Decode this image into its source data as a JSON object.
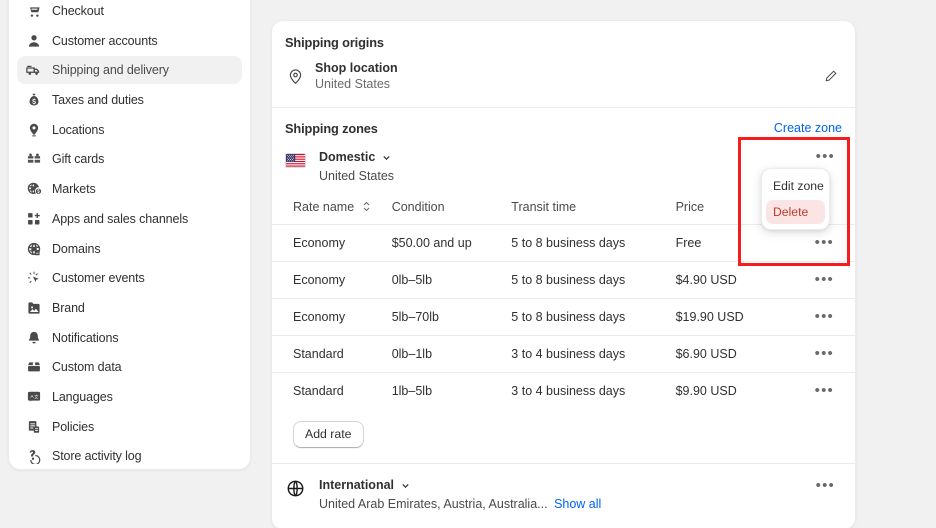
{
  "sidebar": {
    "items": [
      {
        "label": "Checkout",
        "icon": "cart-icon",
        "active": false
      },
      {
        "label": "Customer accounts",
        "icon": "person-icon",
        "active": false
      },
      {
        "label": "Shipping and delivery",
        "icon": "truck-icon",
        "active": true
      },
      {
        "label": "Taxes and duties",
        "icon": "money-bag-icon",
        "active": false
      },
      {
        "label": "Locations",
        "icon": "pin-icon",
        "active": false
      },
      {
        "label": "Gift cards",
        "icon": "gift-card-icon",
        "active": false
      },
      {
        "label": "Markets",
        "icon": "globe-money-icon",
        "active": false
      },
      {
        "label": "Apps and sales channels",
        "icon": "apps-icon",
        "active": false
      },
      {
        "label": "Domains",
        "icon": "domain-globe-icon",
        "active": false
      },
      {
        "label": "Customer events",
        "icon": "cursor-click-icon",
        "active": false
      },
      {
        "label": "Brand",
        "icon": "brand-image-icon",
        "active": false
      },
      {
        "label": "Notifications",
        "icon": "bell-icon",
        "active": false
      },
      {
        "label": "Custom data",
        "icon": "database-icon",
        "active": false
      },
      {
        "label": "Languages",
        "icon": "translate-icon",
        "active": false
      },
      {
        "label": "Policies",
        "icon": "policy-icon",
        "active": false
      },
      {
        "label": "Store activity log",
        "icon": "activity-log-icon",
        "active": false
      }
    ]
  },
  "main": {
    "shipping_origins": {
      "title": "Shipping origins",
      "location_name": "Shop location",
      "location_country": "United States",
      "edit_icon": "pencil-icon"
    },
    "shipping_zones": {
      "title": "Shipping zones",
      "create_zone_label": "Create zone"
    },
    "domestic_zone": {
      "name": "Domestic",
      "countries": "United States",
      "flag_icon": "us-flag-icon",
      "chevron_icon": "chevron-down-icon",
      "menu_icon": "horizontal-dots-icon",
      "columns": [
        "Rate name",
        "Condition",
        "Transit time",
        "Price"
      ],
      "sort_icon": "sort-icon",
      "rows": [
        {
          "rate_name": "Economy",
          "condition": "$50.00 and up",
          "transit_time": "5 to 8 business days",
          "price": "Free"
        },
        {
          "rate_name": "Economy",
          "condition": "0lb–5lb",
          "transit_time": "5 to 8 business days",
          "price": "$4.90 USD"
        },
        {
          "rate_name": "Economy",
          "condition": "5lb–70lb",
          "transit_time": "5 to 8 business days",
          "price": "$19.90 USD"
        },
        {
          "rate_name": "Standard",
          "condition": "0lb–1lb",
          "transit_time": "3 to 4 business days",
          "price": "$6.90 USD"
        },
        {
          "rate_name": "Standard",
          "condition": "1lb–5lb",
          "transit_time": "3 to 4 business days",
          "price": "$9.90 USD"
        }
      ],
      "add_rate_label": "Add rate"
    },
    "international_zone": {
      "name": "International",
      "countries": "United Arab Emirates, Austria, Australia...",
      "show_all_label": "Show all",
      "globe_icon": "globe-icon",
      "chevron_icon": "chevron-down-icon",
      "menu_icon": "horizontal-dots-icon"
    },
    "zone_menu": {
      "edit_label": "Edit zone",
      "delete_label": "Delete"
    }
  },
  "colors": {
    "link": "#0063f7",
    "danger_text": "#c0392b",
    "danger_bg": "#fbe5e4",
    "highlight_border": "#f81d1d",
    "active_nav_bg": "#f1f1f1",
    "page_bg": "#f1f1f1"
  }
}
